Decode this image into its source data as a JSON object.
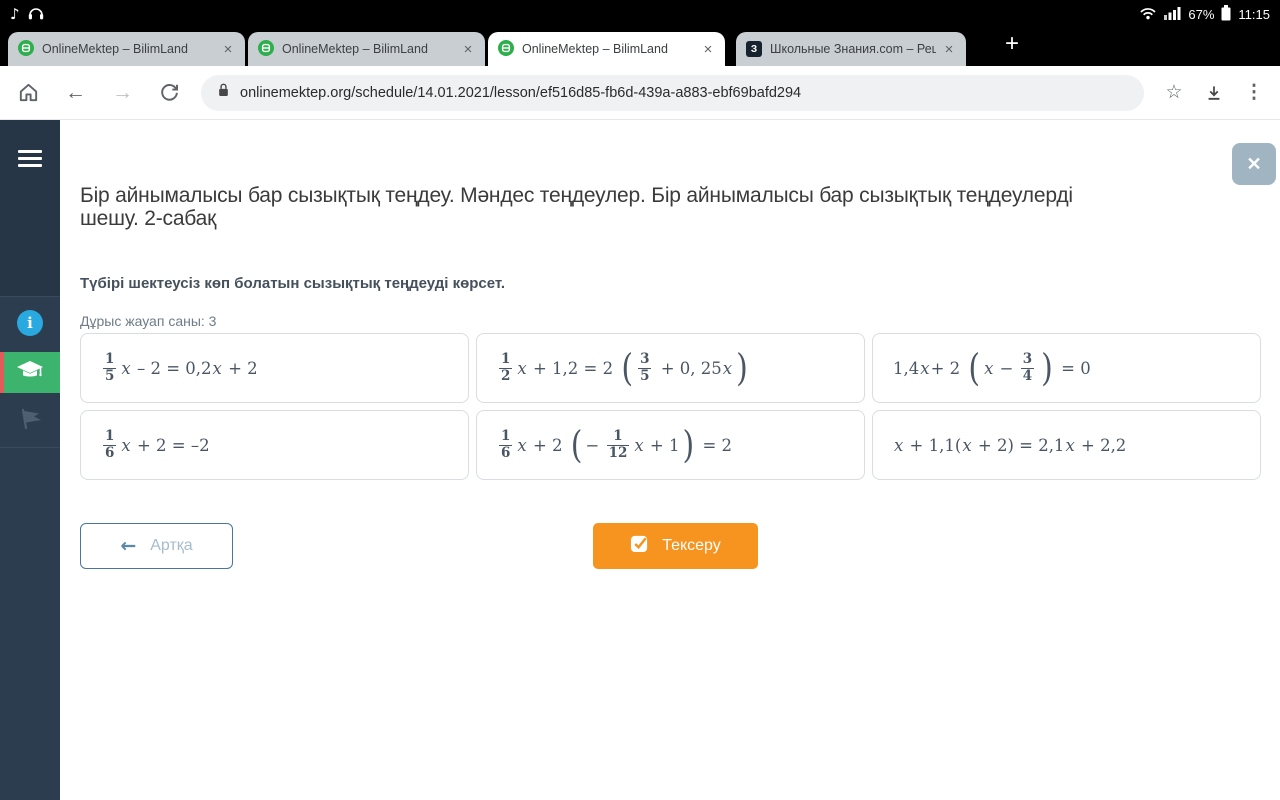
{
  "status_bar": {
    "music_note_glyph": "♪",
    "battery_percent": "67%",
    "time": "11:15"
  },
  "tab_bar": {
    "tabs": [
      {
        "label": "OnlineMektep – BilimLand"
      },
      {
        "label": "OnlineMektep – BilimLand"
      },
      {
        "label": "OnlineMektep – BilimLand"
      },
      {
        "label": "Школьные Знания.com – Реш",
        "favicon_letter": "З"
      }
    ],
    "close_glyph": "×",
    "new_tab_glyph": "+"
  },
  "toolbar": {
    "url": "onlinemektep.org/schedule/14.01.2021/lesson/ef516d85-fb6d-439a-a883-ebf69bafd294",
    "back_glyph": "←",
    "forward_glyph": "→",
    "star_glyph": "☆",
    "menu_glyph": "⋮"
  },
  "sidebar": {
    "info_glyph": "i"
  },
  "lesson": {
    "title_line1": "Бір айнымалысы бар сызықтық теңдеу. Мәндес теңдеулер. Бір айнымалысы бар сызықтық теңдеулерді",
    "title_line2": "шешу. 2-сабақ",
    "close_glyph": "✕",
    "question": "Түбірі шектеусіз көп болатын сызықтық теңдеуді көрсет.",
    "answers_count_label": "Дұрыс жауап саны: 3"
  },
  "answers": [
    {
      "tokens": [
        [
          "frac",
          "1",
          "5"
        ],
        [
          "i",
          "x"
        ],
        [
          "t",
          " – 2 = 0,2"
        ],
        [
          "i",
          "x"
        ],
        [
          "t",
          " + 2"
        ]
      ]
    },
    {
      "tokens": [
        [
          "frac",
          "1",
          "2"
        ],
        [
          "i",
          "x"
        ],
        [
          "t",
          " + 1,2 = 2 "
        ],
        [
          "lp"
        ],
        [
          "frac",
          "3",
          "5"
        ],
        [
          "t",
          " + 0, 25"
        ],
        [
          "i",
          "x"
        ],
        [
          "rp"
        ]
      ]
    },
    {
      "tokens": [
        [
          "t",
          "1,4"
        ],
        [
          "i",
          "x"
        ],
        [
          "t",
          "+ 2 "
        ],
        [
          "lp"
        ],
        [
          "i",
          "x"
        ],
        [
          "t",
          " − "
        ],
        [
          "frac",
          "3",
          "4"
        ],
        [
          "rp"
        ],
        [
          "t",
          " = 0"
        ]
      ]
    },
    {
      "tokens": [
        [
          "frac",
          "1",
          "6"
        ],
        [
          "i",
          "x"
        ],
        [
          "t",
          " + 2 = –2"
        ]
      ]
    },
    {
      "tokens": [
        [
          "frac",
          "1",
          "6"
        ],
        [
          "i",
          "x"
        ],
        [
          "t",
          " + 2 "
        ],
        [
          "lp"
        ],
        [
          "t",
          "− "
        ],
        [
          "frac",
          "1",
          "12"
        ],
        [
          "i",
          "x"
        ],
        [
          "t",
          " + 1"
        ],
        [
          "rp"
        ],
        [
          "t",
          " = 2"
        ]
      ]
    },
    {
      "tokens": [
        [
          "i",
          "x"
        ],
        [
          "t",
          " + 1,1("
        ],
        [
          "i",
          "x"
        ],
        [
          "t",
          " + 2) = 2,1"
        ],
        [
          "i",
          "x"
        ],
        [
          "t",
          " + 2,2"
        ]
      ]
    }
  ],
  "actions": {
    "back_label": "Артқа",
    "back_arrow_glyph": "←",
    "check_label": "Тексеру"
  },
  "colors": {
    "accent_orange": "#F7941F",
    "accent_green": "#3CB46E",
    "info_blue": "#29A9E0",
    "sidebar_navy": "#2C3D4F",
    "active_strip_red": "#E25B5B"
  }
}
